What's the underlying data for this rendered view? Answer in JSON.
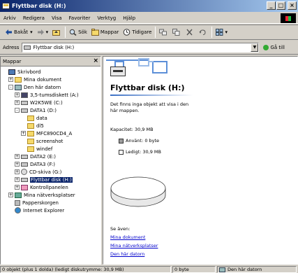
{
  "window": {
    "title": "Flyttbar disk (H:)"
  },
  "menu": [
    {
      "label": "Arkiv"
    },
    {
      "label": "Redigera"
    },
    {
      "label": "Visa"
    },
    {
      "label": "Favoriter"
    },
    {
      "label": "Verktyg"
    },
    {
      "label": "Hjälp"
    }
  ],
  "toolbar": {
    "back": "Bakåt",
    "search": "Sök",
    "folders": "Mappar",
    "history": "Tidigare"
  },
  "address": {
    "label": "Adress",
    "value": "Flyttbar disk (H:)",
    "go": "Gå till"
  },
  "folders_pane": {
    "title": "Mappar"
  },
  "tree": [
    {
      "label": "Skrivbord",
      "icon": "desktop",
      "indent": 0,
      "toggle": ""
    },
    {
      "label": "Mina dokument",
      "icon": "folder",
      "indent": 1,
      "toggle": "+"
    },
    {
      "label": "Den här datorn",
      "icon": "computer",
      "indent": 1,
      "toggle": "-"
    },
    {
      "label": "3,5-tumsdiskett (A:)",
      "icon": "floppy",
      "indent": 2,
      "toggle": "+"
    },
    {
      "label": "W2K5WE (C:)",
      "icon": "drive",
      "indent": 2,
      "toggle": "+"
    },
    {
      "label": "DATA1 (D:)",
      "icon": "drive",
      "indent": 2,
      "toggle": "-"
    },
    {
      "label": "data",
      "icon": "folder",
      "indent": 3,
      "toggle": ""
    },
    {
      "label": "dl5",
      "icon": "folder",
      "indent": 3,
      "toggle": ""
    },
    {
      "label": "MFC890CD4_A",
      "icon": "folder",
      "indent": 3,
      "toggle": "+"
    },
    {
      "label": "screenshot",
      "icon": "folder",
      "indent": 3,
      "toggle": ""
    },
    {
      "label": "windef",
      "icon": "folder",
      "indent": 3,
      "toggle": ""
    },
    {
      "label": "DATA2 (E:)",
      "icon": "drive",
      "indent": 2,
      "toggle": "+"
    },
    {
      "label": "DATA3 (F:)",
      "icon": "drive",
      "indent": 2,
      "toggle": "+"
    },
    {
      "label": "CD-skiva (G:)",
      "icon": "cd",
      "indent": 2,
      "toggle": "+"
    },
    {
      "label": "Flyttbar disk (H:)",
      "icon": "drive",
      "indent": 2,
      "toggle": "+",
      "selected": true
    },
    {
      "label": "Kontrollpanelen",
      "icon": "cpl",
      "indent": 2,
      "toggle": "+"
    },
    {
      "label": "Mina nätverksplatser",
      "icon": "net",
      "indent": 1,
      "toggle": "+"
    },
    {
      "label": "Papperskorgen",
      "icon": "trash",
      "indent": 1,
      "toggle": ""
    },
    {
      "label": "Internet Explorer",
      "icon": "ie",
      "indent": 1,
      "toggle": ""
    }
  ],
  "content": {
    "drive_title": "Flyttbar disk (H:)",
    "description": "Det finns inga objekt att visa i den här mappen.",
    "capacity": "Kapacitet: 30,9 MB",
    "used": "Använt: 0 byte",
    "free": "Ledigt: 30,9 MB",
    "used_fraction": 0,
    "see_also": "Se även:",
    "links": [
      "Mina dokument",
      "Mina nätverksplatser",
      "Den här datorn"
    ]
  },
  "status": {
    "objects": "0 objekt (plus 1 dolda) (ledigt diskutrymme: 30,9 MB)",
    "size": "0 byte",
    "zone": "Den här datorn"
  },
  "colors": {
    "title_start": "#0a246a",
    "title_end": "#a6caf0",
    "accent": "#5c8fd8",
    "link": "#0000cc"
  }
}
